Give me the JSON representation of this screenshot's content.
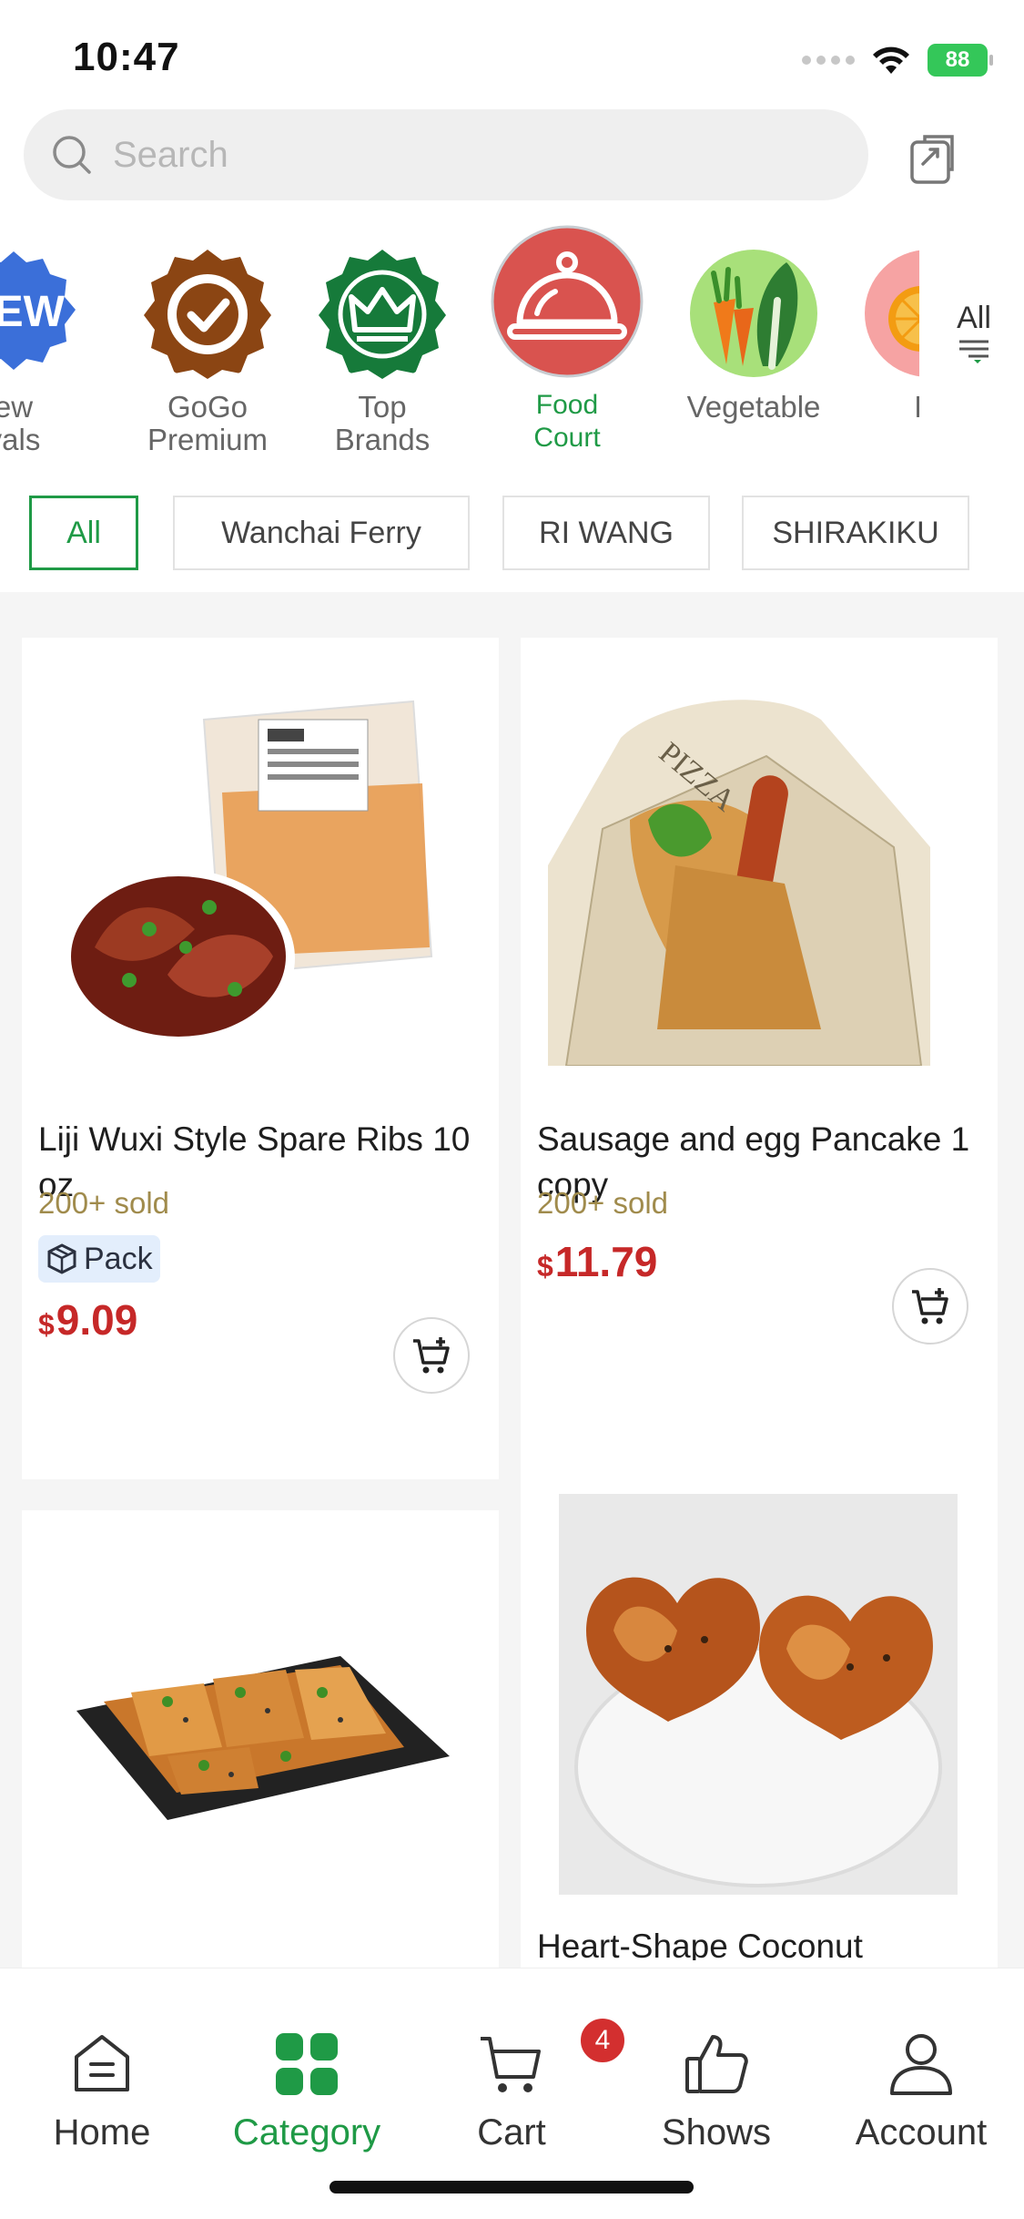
{
  "status_bar": {
    "time": "10:47",
    "battery": "88"
  },
  "search": {
    "placeholder": "Search"
  },
  "categories": [
    {
      "label": "ew\nvals",
      "icon": "new-arrivals-icon",
      "color": "#3b6fd9"
    },
    {
      "label": "GoGo\nPremium",
      "icon": "premium-badge-icon",
      "color": "#8b4513"
    },
    {
      "label": "Top\nBrands",
      "icon": "crown-badge-icon",
      "color": "#167a3a"
    },
    {
      "label": "Food\nCourt",
      "icon": "food-cloche-icon",
      "color": "#d9534f",
      "active": true
    },
    {
      "label": "Vegetable",
      "icon": "vegetable-icon"
    },
    {
      "label": "Fr",
      "icon": "fruit-icon"
    }
  ],
  "categories_all": {
    "label": "All"
  },
  "brands": [
    {
      "label": "All",
      "active": true
    },
    {
      "label": "Wanchai Ferry"
    },
    {
      "label": "RI WANG"
    },
    {
      "label": "SHIRAKIKU"
    }
  ],
  "products": [
    {
      "title": "Liji Wuxi Style Spare Ribs 10 oz",
      "sold": "200+ sold",
      "badge": "Pack",
      "currency": "$",
      "price": "9.09"
    },
    {
      "title": "Sausage and egg Pancake 1 copy",
      "sold": "200+ sold",
      "currency": "$",
      "price": "11.79"
    },
    {
      "title": ""
    },
    {
      "title": "Heart-Shape Coconut"
    }
  ],
  "tabs": [
    {
      "label": "Home",
      "icon": "home-icon"
    },
    {
      "label": "Category",
      "icon": "category-grid-icon",
      "active": true
    },
    {
      "label": "Cart",
      "icon": "cart-icon",
      "badge": "4"
    },
    {
      "label": "Shows",
      "icon": "thumbs-up-icon"
    },
    {
      "label": "Account",
      "icon": "account-icon"
    }
  ],
  "colors": {
    "accent": "#1f9a46",
    "price": "#c62828",
    "sold": "#a08b4c"
  }
}
